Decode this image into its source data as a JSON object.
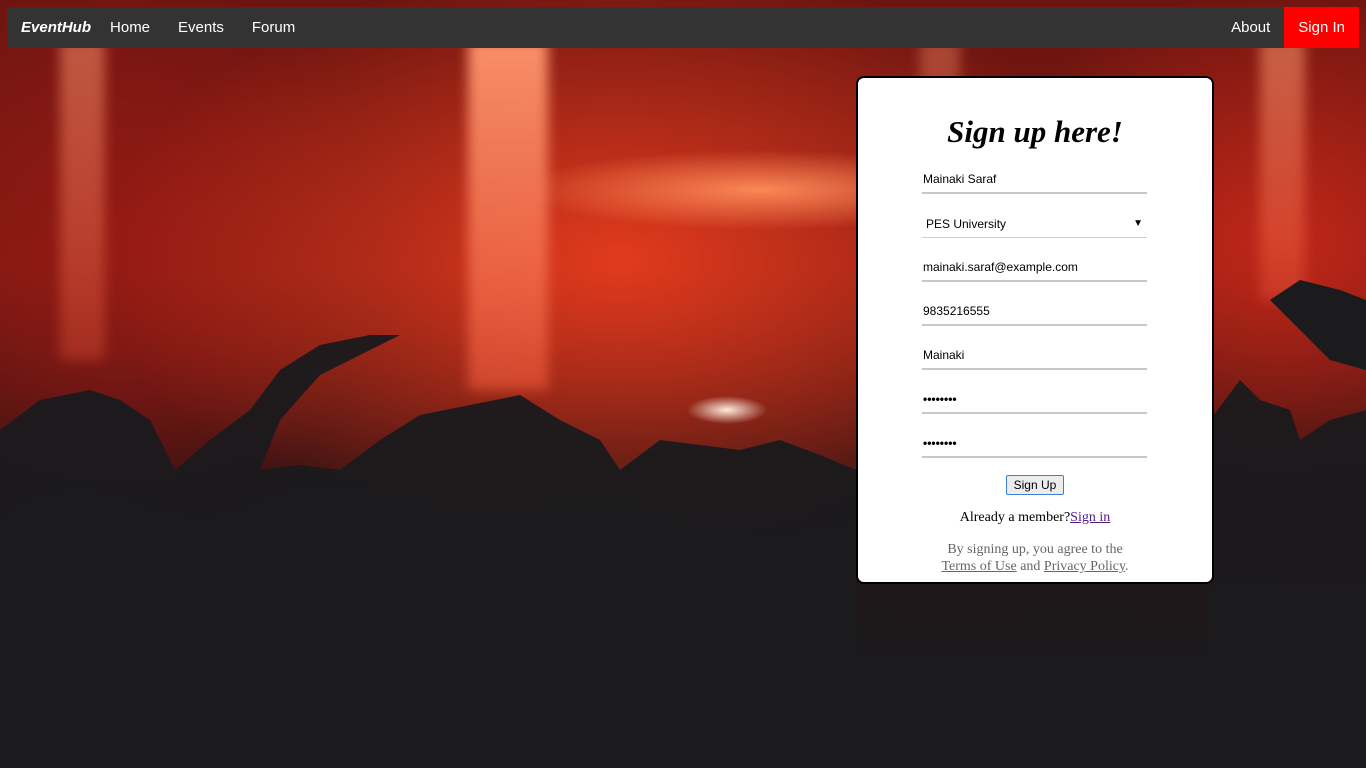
{
  "navbar": {
    "brand": "EventHub",
    "links": [
      "Home",
      "Events",
      "Forum"
    ],
    "about": "About",
    "signin": "Sign In"
  },
  "colors": {
    "navbar_bg": "#333333",
    "signin_bg": "#ff0000",
    "card_bg": "#ffffff",
    "page_bg": "#1b1a1d"
  },
  "form": {
    "title": "Sign up here!",
    "name": "Mainaki Saraf",
    "college": "PES University",
    "email": "mainaki.saraf@example.com",
    "phone": "9835216555",
    "username": "Mainaki",
    "password": "••••••••",
    "confirm_password": "••••••••",
    "submit": "Sign Up",
    "member_text": "Already a member?",
    "member_link": "Sign in",
    "terms_prefix": "By signing up, you agree to the",
    "terms_link": "Terms of Use",
    "terms_and": "and",
    "privacy_link": "Privacy Policy",
    "terms_suffix": "."
  }
}
